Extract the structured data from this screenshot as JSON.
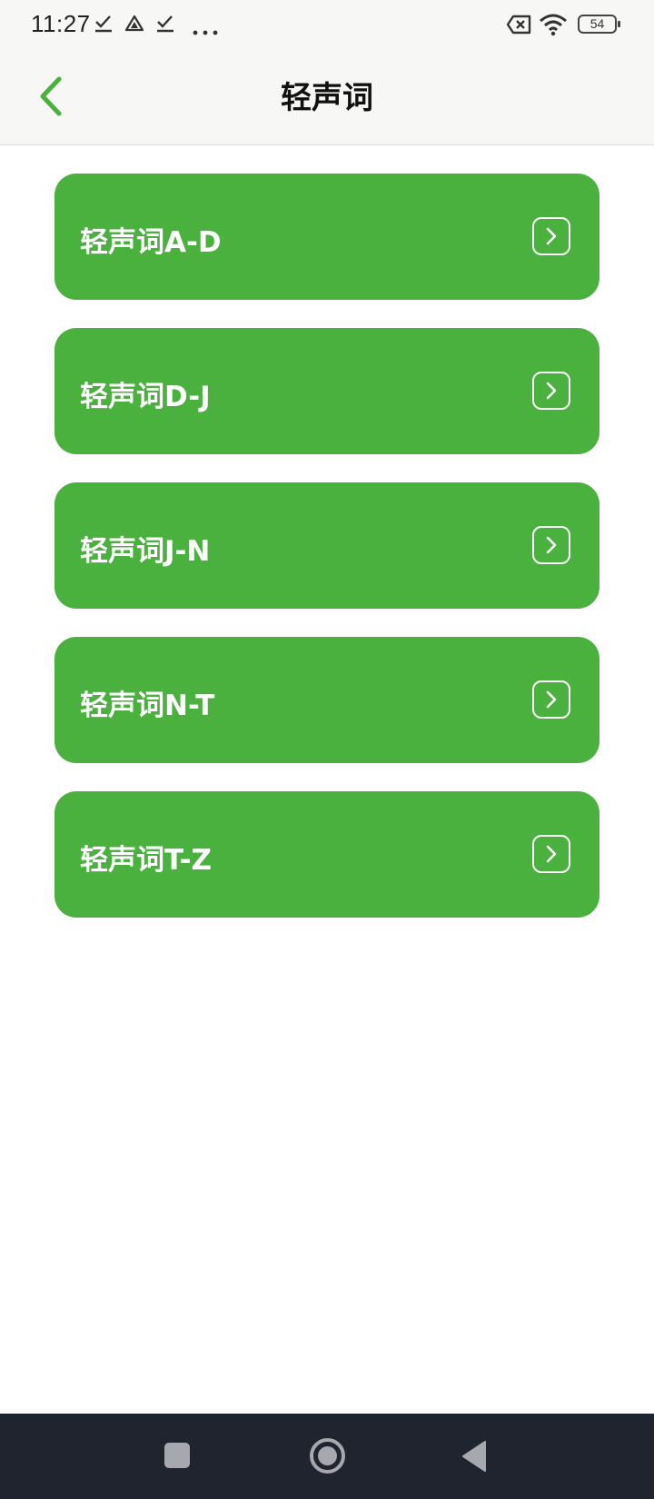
{
  "status_bar": {
    "time": "11:27",
    "battery": "54"
  },
  "app_bar": {
    "title": "轻声词",
    "back_icon": "chevron-left-icon"
  },
  "list": {
    "items": [
      {
        "label": "轻声词A-D"
      },
      {
        "label": "轻声词D-J"
      },
      {
        "label": "轻声词J-N"
      },
      {
        "label": "轻声词N-T"
      },
      {
        "label": "轻声词T-Z"
      }
    ]
  },
  "colors": {
    "accent": "#4ab03e",
    "app_bar_bg": "#f7f7f5",
    "nav_bar_bg": "#20242e"
  }
}
